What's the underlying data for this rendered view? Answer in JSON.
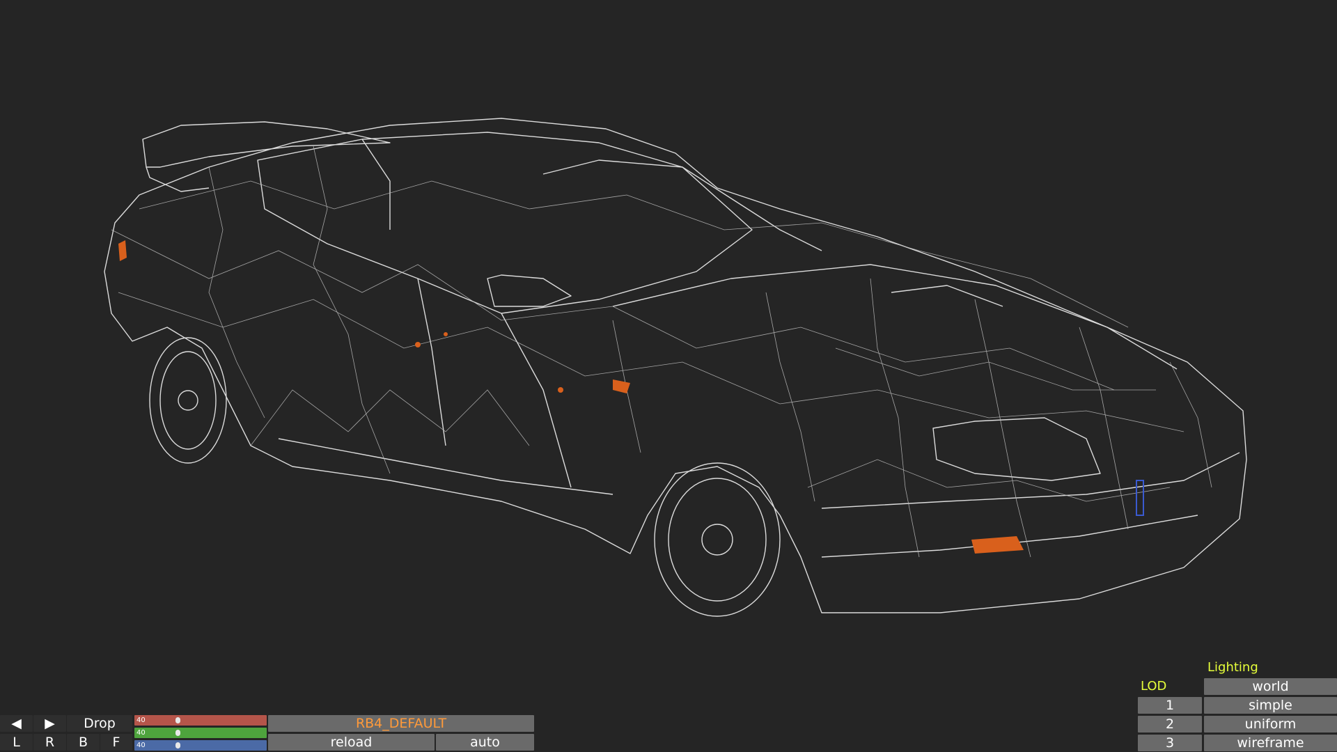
{
  "toolbar": {
    "prev_icon": "triangle-left-icon",
    "next_icon": "triangle-right-icon",
    "prev_glyph": "◀",
    "next_glyph": "▶",
    "drop_label": "Drop",
    "view_buttons": [
      "L",
      "R",
      "B",
      "F"
    ],
    "config_name": "RB4_DEFAULT",
    "config_color": "#ff9a3a",
    "reload_label": "reload",
    "auto_label": "auto"
  },
  "sliders": [
    {
      "label": "40",
      "color": "#b5554a",
      "level": 0.31
    },
    {
      "label": "40",
      "color": "#4ea43d",
      "level": 0.31
    },
    {
      "label": "40",
      "color": "#4b6aa6",
      "level": 0.31
    }
  ],
  "lighting": {
    "title": "Lighting",
    "modes": [
      "world",
      "simple",
      "uniform",
      "wireframe"
    ]
  },
  "lod": {
    "title": "LOD",
    "levels": [
      "1",
      "2",
      "3"
    ]
  },
  "colors": {
    "background": "#252525",
    "wireframe": "#e9e9e9",
    "button": "#6a6a6a",
    "label_accent": "#e6ff3a",
    "indicator_orange": "#d9601c"
  }
}
